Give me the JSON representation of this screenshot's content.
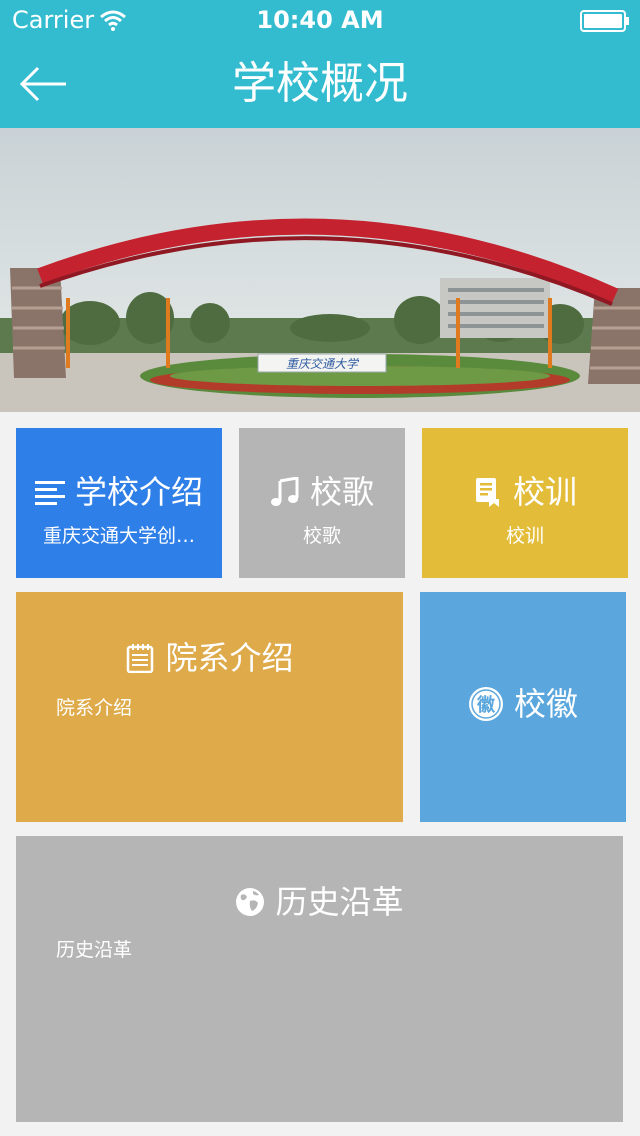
{
  "status_bar": {
    "carrier": "Carrier",
    "time": "10:40 AM",
    "wifi_icon": "wifi-icon",
    "battery_icon": "battery-icon"
  },
  "nav": {
    "title": "学校概况",
    "back_icon": "back-arrow-icon"
  },
  "hero": {
    "gate_sign": "重庆交通大学"
  },
  "tiles": {
    "intro": {
      "title": "学校介绍",
      "subtitle": "重庆交通大学创…",
      "icon": "lines-icon"
    },
    "song": {
      "title": "校歌",
      "subtitle": "校歌",
      "icon": "music-note-icon"
    },
    "motto": {
      "title": "校训",
      "subtitle": "校训",
      "icon": "document-icon"
    },
    "dept": {
      "title": "院系介绍",
      "subtitle": "院系介绍",
      "icon": "notepad-icon"
    },
    "emblem": {
      "title": "校徽",
      "icon_text": "徽",
      "icon": "emblem-icon"
    },
    "history": {
      "title": "历史沿革",
      "subtitle": "历史沿革",
      "icon": "globe-icon"
    }
  },
  "colors": {
    "nav_bg": "#33bccf",
    "page_bg": "#f2f2f2",
    "intro": "#2f7fe8",
    "song": "#b5b5b5",
    "motto": "#e3bd3a",
    "dept": "#deaa4a",
    "emblem": "#5ba7dd",
    "history": "#b5b5b5"
  }
}
